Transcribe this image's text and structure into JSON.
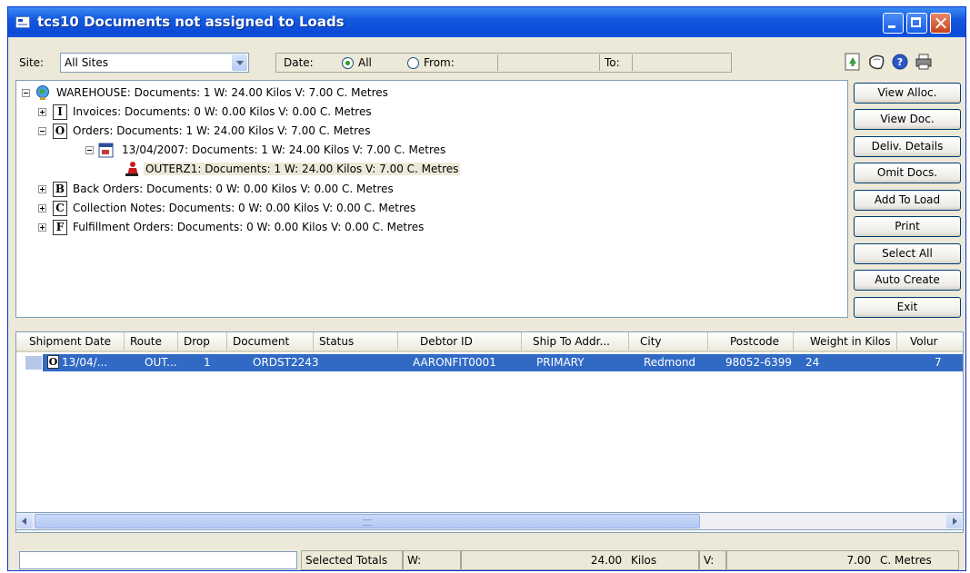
{
  "window": {
    "title": "tcs10 Documents not assigned to Loads"
  },
  "toolbar": {
    "site_label": "Site:",
    "site_value": "All Sites",
    "date_label": "Date:",
    "all_label": "All",
    "from_label": "From:",
    "to_label": "To:"
  },
  "tree": {
    "root": "WAREHOUSE: Documents: 1   W: 24.00 Kilos   V: 7.00 C. Metres",
    "nodes": [
      {
        "icon": "I",
        "text": "Invoices: Documents: 0   W: 0.00 Kilos   V: 0.00 C. Metres"
      },
      {
        "icon": "O",
        "text": "Orders: Documents: 1   W: 24.00 Kilos   V: 7.00 C. Metres"
      },
      {
        "icon": "",
        "text": "13/04/2007: Documents: 1   W: 24.00 Kilos   V: 7.00 C. Metres"
      },
      {
        "icon": "",
        "text": "OUTERZ1: Documents: 1   W: 24.00 Kilos   V: 7.00 C. Metres"
      },
      {
        "icon": "B",
        "text": "Back Orders: Documents: 0   W: 0.00 Kilos   V: 0.00 C. Metres"
      },
      {
        "icon": "C",
        "text": "Collection Notes: Documents: 0   W: 0.00 Kilos   V: 0.00 C. Metres"
      },
      {
        "icon": "F",
        "text": "Fulfillment Orders: Documents: 0   W: 0.00 Kilos   V: 0.00 C. Metres"
      }
    ]
  },
  "buttons": [
    "View Alloc.",
    "View Doc.",
    "Deliv. Details",
    "Omit Docs.",
    "Add To Load",
    "Print",
    "Select All",
    "Auto Create",
    "Exit"
  ],
  "grid": {
    "columns": [
      "Shipment Date",
      "Route",
      "Drop",
      "Document",
      "Status",
      "Debtor ID",
      "Ship To Addr...",
      "City",
      "Postcode",
      "Weight in Kilos",
      "Volur"
    ],
    "row": {
      "icon": "O",
      "cells": [
        "13/04/...",
        "OUT...",
        "1",
        "ORDST2243",
        "",
        "AARONFIT0001",
        "PRIMARY",
        "Redmond",
        "98052-6399",
        "24",
        "7"
      ]
    }
  },
  "status": {
    "input_value": "",
    "selected_totals_label": "Selected Totals",
    "w_label": "W:",
    "weight_value": "24.00",
    "weight_unit": "Kilos",
    "v_label": "V:",
    "volume_value": "7.00",
    "volume_unit": "C. Metres"
  }
}
